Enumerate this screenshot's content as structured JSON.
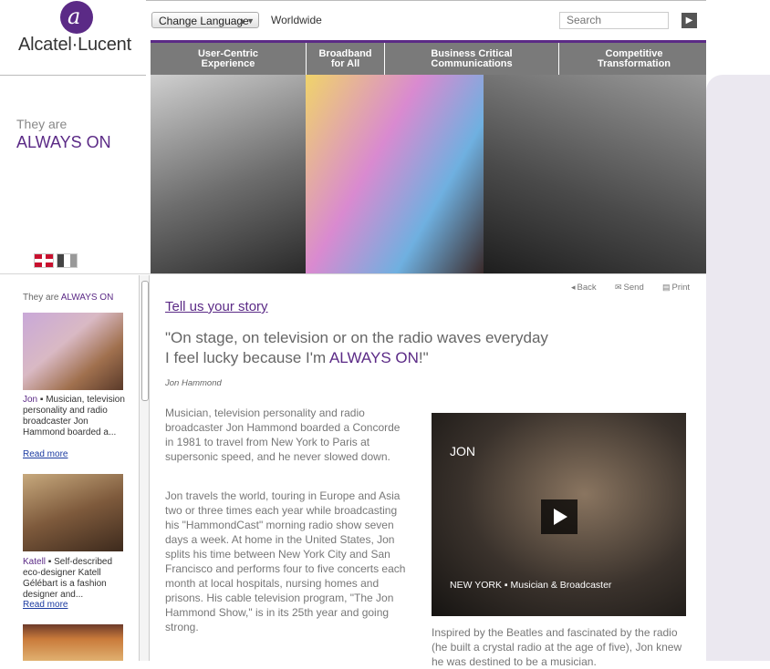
{
  "brand": {
    "logo_letter": "a",
    "name": "Alcatel·Lucent"
  },
  "topbar": {
    "language_button": "Change Language",
    "region": "Worldwide",
    "search_placeholder": "Search",
    "search_go": "▶"
  },
  "nav": {
    "tabs": [
      {
        "label": "User-Centric\nExperience",
        "width": 170
      },
      {
        "label": "Broadband\nfor All",
        "width": 85
      },
      {
        "label": "Business Critical\nCommunications",
        "width": 190
      },
      {
        "label": "Competitive\nTransformation",
        "width": 164
      }
    ]
  },
  "tagline": {
    "line1": "They are",
    "line2": "ALWAYS ON"
  },
  "sidebar": {
    "heading_prefix": "They are ",
    "heading_accent": "ALWAYS ON",
    "items": [
      {
        "name": "Jon",
        "text": " ▪ Musician, television personality and radio broadcaster Jon Hammond boarded a...",
        "more": "Read more"
      },
      {
        "name": "Katell",
        "text": " ▪ Self-described eco-designer Katell Gélébart is a fashion designer and...",
        "more": "Read more"
      }
    ]
  },
  "utility": {
    "back": "Back",
    "send": "Send",
    "print": "Print"
  },
  "article": {
    "link": "Tell us your story",
    "quote_main": "\"On stage, on television or on the radio waves everyday I feel lucky because I'm ",
    "quote_accent": "ALWAYS ON",
    "quote_end": "!\"",
    "author": "Jon Hammond",
    "para1": "Musician, television personality and radio broadcaster Jon Hammond boarded a Concorde in 1981 to travel from New York to Paris at supersonic speed, and he never slowed down.",
    "para2": "Jon travels the world, touring in Europe and Asia two or three times each year while broadcasting his \"HammondCast\" morning radio show seven days a week. At home in the United States, Jon splits his time between New York City and San Francisco and performs four to five concerts each month at local hospitals, nursing homes and prisons. His cable television program, \"The Jon Hammond Show,\" is in its 25th year and going strong.",
    "video_title": "JON",
    "video_caption": "NEW YORK ▪ Musician & Broadcaster",
    "video_desc": "Inspired by the Beatles and fascinated by the radio (he built a crystal radio at the age of five), Jon knew he was destined to be a musician."
  },
  "colors": {
    "brand_purple": "#5b2a86",
    "nav_gray": "#7a7a7a",
    "link_blue": "#1a3aa0"
  }
}
